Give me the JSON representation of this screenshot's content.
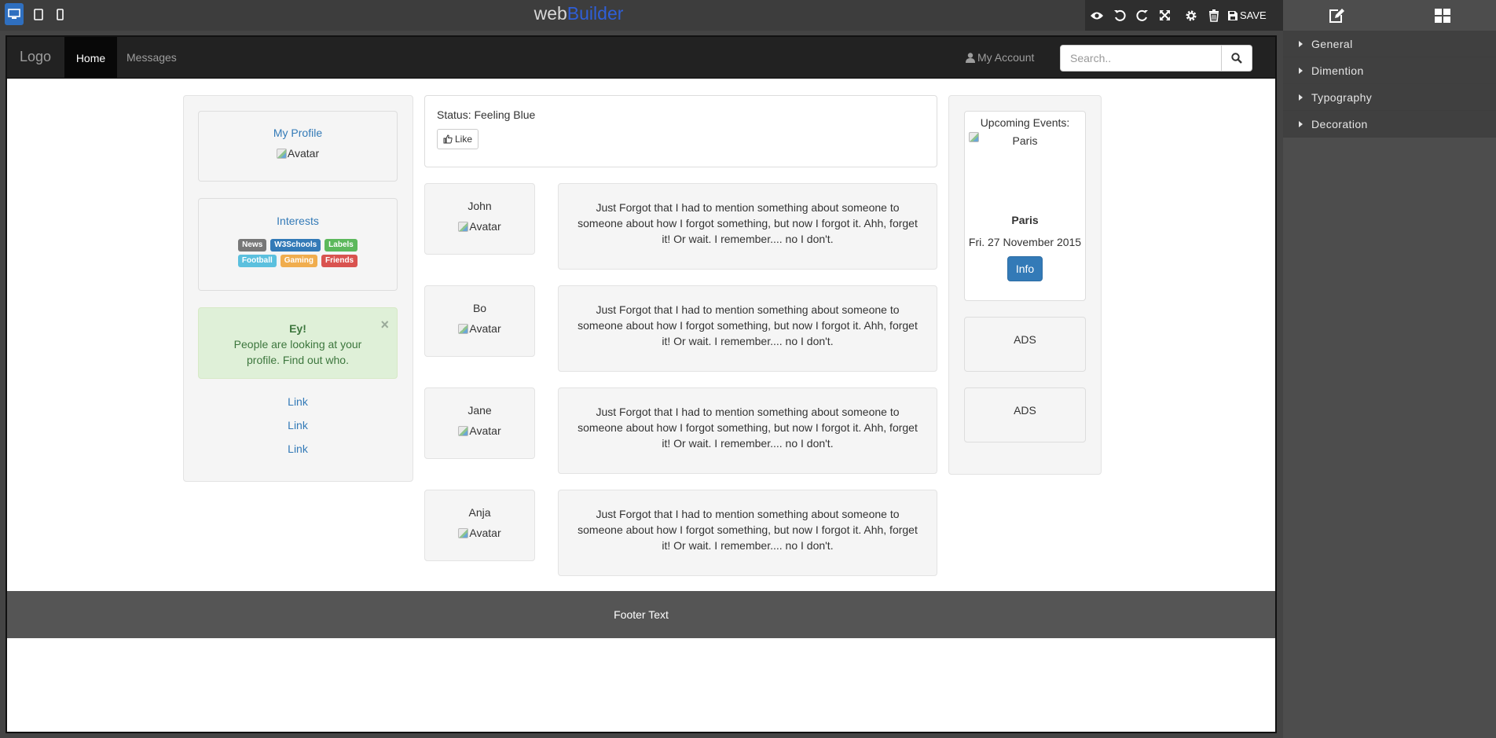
{
  "builder": {
    "brand_part1": "web",
    "brand_part2": "Builder",
    "save_label": "SAVE",
    "panel_sections": [
      "General",
      "Dimention",
      "Typography",
      "Decoration"
    ]
  },
  "nav": {
    "logo": "Logo",
    "home": "Home",
    "messages": "Messages",
    "account": "My Account",
    "search_placeholder": "Search.."
  },
  "left": {
    "profile_title": "My Profile",
    "avatar_alt": "Avatar",
    "interests_title": "Interests",
    "labels": [
      {
        "text": "News",
        "color": "#777777"
      },
      {
        "text": "W3Schools",
        "color": "#337ab7"
      },
      {
        "text": "Labels",
        "color": "#5cb85c"
      },
      {
        "text": "Football",
        "color": "#5bc0de"
      },
      {
        "text": "Gaming",
        "color": "#f0ad4e"
      },
      {
        "text": "Friends",
        "color": "#d9534f"
      }
    ],
    "alert_title": "Ey!",
    "alert_text": "People are looking at your profile. Find out who.",
    "alert_close": "×",
    "links": [
      "Link",
      "Link",
      "Link"
    ]
  },
  "middle": {
    "status": "Status: Feeling Blue",
    "like_label": "Like",
    "posts": [
      {
        "name": "John",
        "avatar": "Avatar",
        "text": "Just Forgot that I had to mention something about someone to someone about how I forgot something, but now I forgot it. Ahh, forget it! Or wait. I remember.... no I don't."
      },
      {
        "name": "Bo",
        "avatar": "Avatar",
        "text": "Just Forgot that I had to mention something about someone to someone about how I forgot something, but now I forgot it. Ahh, forget it! Or wait. I remember.... no I don't."
      },
      {
        "name": "Jane",
        "avatar": "Avatar",
        "text": "Just Forgot that I had to mention something about someone to someone about how I forgot something, but now I forgot it. Ahh, forget it! Or wait. I remember.... no I don't."
      },
      {
        "name": "Anja",
        "avatar": "Avatar",
        "text": "Just Forgot that I had to mention something about someone to someone about how I forgot something, but now I forgot it. Ahh, forget it! Or wait. I remember.... no I don't."
      }
    ]
  },
  "right": {
    "events_title": "Upcoming Events:",
    "event_image_alt": "Paris",
    "event_name": "Paris",
    "event_date": "Fri. 27 November 2015",
    "info_label": "Info",
    "ads": [
      "ADS",
      "ADS"
    ]
  },
  "footer": {
    "text": "Footer Text"
  }
}
